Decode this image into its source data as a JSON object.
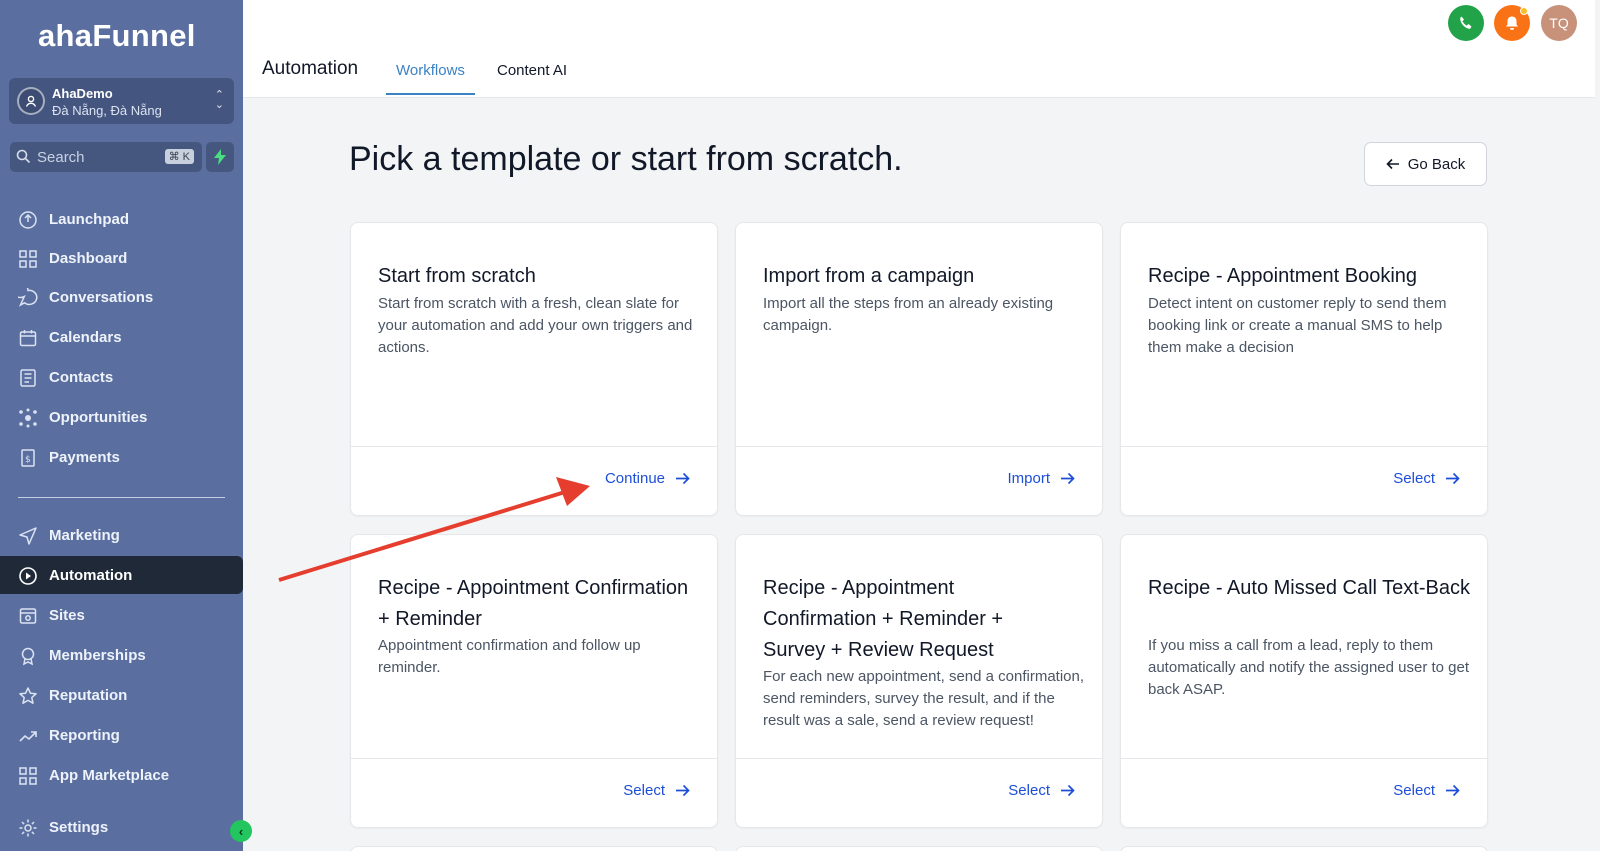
{
  "brand": {
    "logo": "ahaFunnel"
  },
  "account": {
    "name": "AhaDemo",
    "location": "Đà Nẵng, Đà Nẵng"
  },
  "search": {
    "placeholder": "Search",
    "shortcut": "⌘ K"
  },
  "sidebar": {
    "items": [
      {
        "label": "Launchpad",
        "icon": "launchpad-icon"
      },
      {
        "label": "Dashboard",
        "icon": "grid-icon"
      },
      {
        "label": "Conversations",
        "icon": "chat-icon"
      },
      {
        "label": "Calendars",
        "icon": "calendar-icon"
      },
      {
        "label": "Contacts",
        "icon": "contacts-icon"
      },
      {
        "label": "Opportunities",
        "icon": "opportunities-icon"
      },
      {
        "label": "Payments",
        "icon": "payments-icon"
      },
      {
        "label": "Marketing",
        "icon": "send-icon"
      },
      {
        "label": "Automation",
        "icon": "automation-icon"
      },
      {
        "label": "Sites",
        "icon": "sites-icon"
      },
      {
        "label": "Memberships",
        "icon": "badge-icon"
      },
      {
        "label": "Reputation",
        "icon": "star-icon"
      },
      {
        "label": "Reporting",
        "icon": "trend-icon"
      },
      {
        "label": "App Marketplace",
        "icon": "apps-icon"
      },
      {
        "label": "Settings",
        "icon": "gear-icon"
      }
    ],
    "active": "Automation"
  },
  "header": {
    "title": "Automation",
    "tabs": [
      {
        "label": "Workflows",
        "active": true
      },
      {
        "label": "Content AI",
        "active": false
      }
    ],
    "user_initials": "TQ"
  },
  "main": {
    "title": "Pick a template or start from scratch.",
    "go_back": "Go Back",
    "cards": [
      {
        "title": "Start from scratch",
        "description": "Start from scratch with a fresh, clean slate for your automation and add your own triggers and actions.",
        "action": "Continue"
      },
      {
        "title": "Import from a campaign",
        "description": "Import all the steps from an already existing campaign.",
        "action": "Import"
      },
      {
        "title": "Recipe - Appointment Booking",
        "description": "Detect intent on customer reply to send them booking link or create a manual SMS to help them make a decision",
        "action": "Select"
      },
      {
        "title": "Recipe - Appointment Confirmation + Reminder",
        "description": "Appointment confirmation and follow up reminder.",
        "action": "Select"
      },
      {
        "title": "Recipe - Appointment Confirmation + Reminder + Survey + Review Request",
        "description": "For each new appointment, send a confirmation, send reminders, survey the result, and if the result was a sale, send a review request!",
        "action": "Select"
      },
      {
        "title": "Recipe - Auto Missed Call Text-Back",
        "description": "If you miss a call from a lead, reply to them automatically and notify the assigned user to get back ASAP.",
        "action": "Select"
      }
    ]
  },
  "colors": {
    "sidebar": "#5a6f9f",
    "accent": "#1d4ed8",
    "tab_active": "#3b82c4",
    "annotation_arrow": "#e53e2e"
  }
}
